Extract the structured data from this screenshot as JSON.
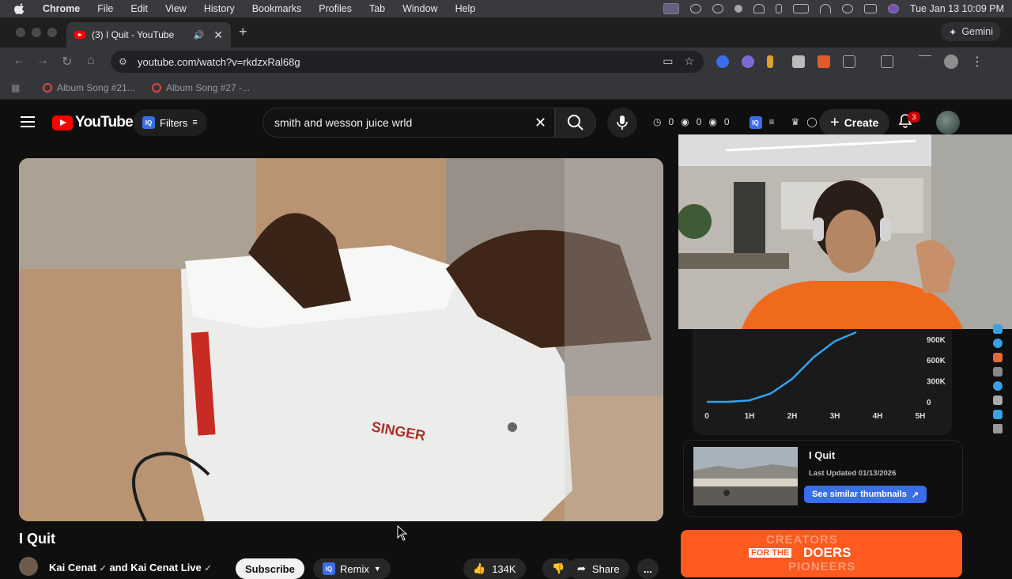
{
  "menubar": {
    "app": "Chrome",
    "items": [
      "File",
      "Edit",
      "View",
      "History",
      "Bookmarks",
      "Profiles",
      "Tab",
      "Window",
      "Help"
    ],
    "clock": "Tue Jan 13  10:09 PM"
  },
  "tab": {
    "title": "(3) I Quit - YouTube",
    "new_tab": "+"
  },
  "gemini": {
    "label": "Gemini"
  },
  "omnibox": {
    "url": "youtube.com/watch?v=rkdzxRal68g"
  },
  "bookmarks": [
    {
      "label": "Album Song #21..."
    },
    {
      "label": "Album Song #27 -..."
    }
  ],
  "youtube": {
    "logo": "YouTube",
    "filters": "Filters",
    "iq": "IQ",
    "search_query": "smith and wesson juice wrld",
    "stats": [
      "0",
      "0",
      "0"
    ],
    "create": "Create",
    "notification_count": "3"
  },
  "video": {
    "title": "I Quit",
    "channel": "Kai Cenat",
    "and_label": "and",
    "channel2": "Kai Cenat Live",
    "subscribe": "Subscribe",
    "remix": "Remix",
    "likes": "134K",
    "share": "Share",
    "more": "..."
  },
  "chart_data": {
    "type": "line",
    "x_ticks": [
      "0",
      "1H",
      "2H",
      "3H",
      "4H",
      "5H"
    ],
    "y_ticks": [
      "0",
      "300K",
      "600K",
      "900K"
    ],
    "series": [
      {
        "x": [
          0,
          0.5,
          1,
          1.5,
          2,
          2.5,
          3,
          3.5
        ],
        "y": [
          0,
          0,
          20000,
          120000,
          330000,
          640000,
          870000,
          1000000
        ]
      }
    ]
  },
  "thumbnail_card": {
    "title": "I Quit",
    "updated": "Last Updated 01/13/2026",
    "button": "See similar thumbnails"
  },
  "promo": {
    "line1": "CREATORS",
    "line2_a": "FOR THE",
    "line2_b": "DOERS",
    "line3": "PIONEERS"
  },
  "colors": {
    "yt_red": "#ff0000",
    "iq_blue": "#3a6ee8",
    "chart_line": "#2fa4f5",
    "promo_orange": "#ff5a1f"
  }
}
